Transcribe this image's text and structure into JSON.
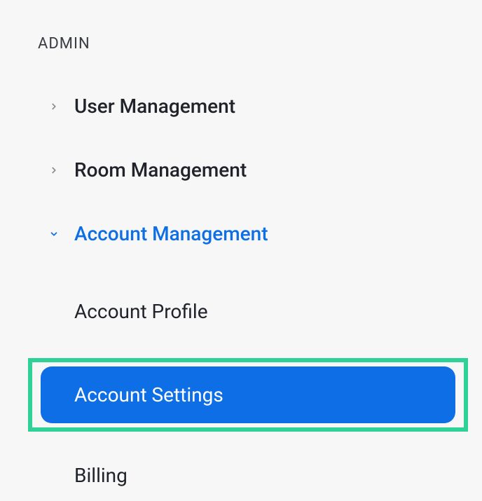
{
  "section": {
    "header": "ADMIN"
  },
  "nav": {
    "items": [
      {
        "label": "User Management",
        "expanded": false
      },
      {
        "label": "Room Management",
        "expanded": false
      },
      {
        "label": "Account Management",
        "expanded": true
      }
    ]
  },
  "subnav": {
    "items": [
      {
        "label": "Account Profile",
        "selected": false,
        "highlighted": false
      },
      {
        "label": "Account Settings",
        "selected": true,
        "highlighted": true
      },
      {
        "label": "Billing",
        "selected": false,
        "highlighted": false
      }
    ]
  },
  "colors": {
    "accent": "#0e6ee6",
    "highlight_border": "#2fd296",
    "text": "#20232a",
    "muted": "#3a3d42",
    "bg": "#f7f7f8"
  }
}
